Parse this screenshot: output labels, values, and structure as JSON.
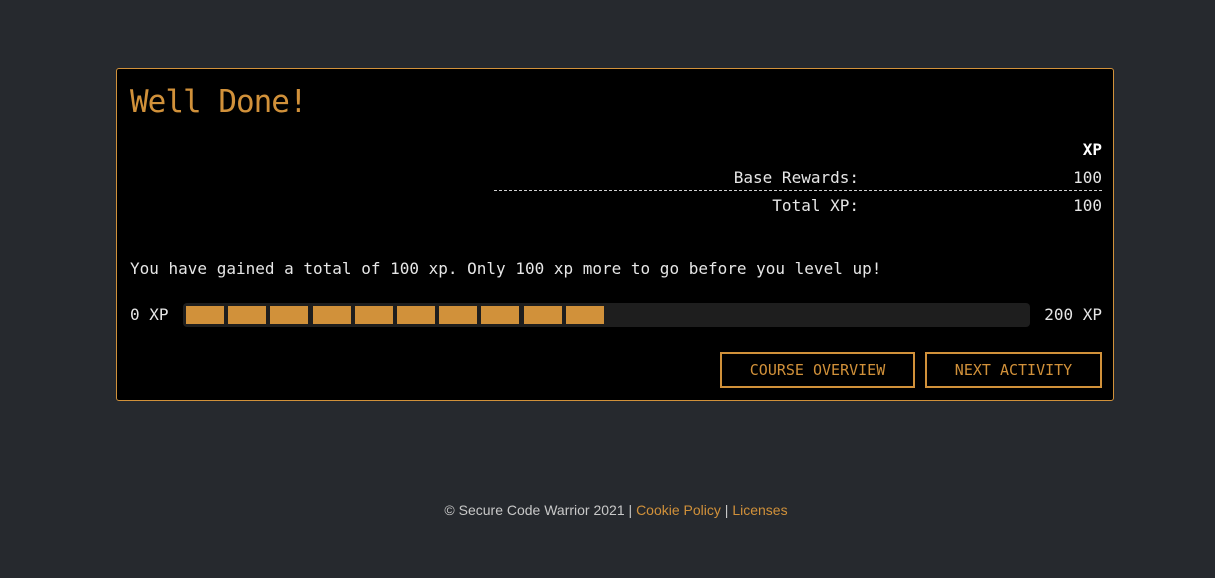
{
  "card": {
    "title": "Well Done!",
    "xp_table": {
      "header": "XP",
      "rows": [
        {
          "label": "Base Rewards:",
          "value": "100"
        },
        {
          "label": "Total XP:",
          "value": "100"
        }
      ]
    },
    "message": "You have gained a total of 100 xp. Only 100 xp more to go before you level up!",
    "progress": {
      "min_label": "0 XP",
      "max_label": "200 XP",
      "current_xp": 100,
      "max_xp": 200,
      "filled_segments": 10,
      "total_segments": 20
    },
    "buttons": {
      "course_overview": "COURSE OVERVIEW",
      "next_activity": "NEXT ACTIVITY"
    }
  },
  "footer": {
    "copyright": "© Secure Code Warrior 2021 |",
    "separator": "|",
    "cookie_policy": "Cookie Policy",
    "licenses": "Licenses"
  },
  "colors": {
    "accent": "#d1913a",
    "background": "#26292e",
    "card_background": "#000000"
  }
}
